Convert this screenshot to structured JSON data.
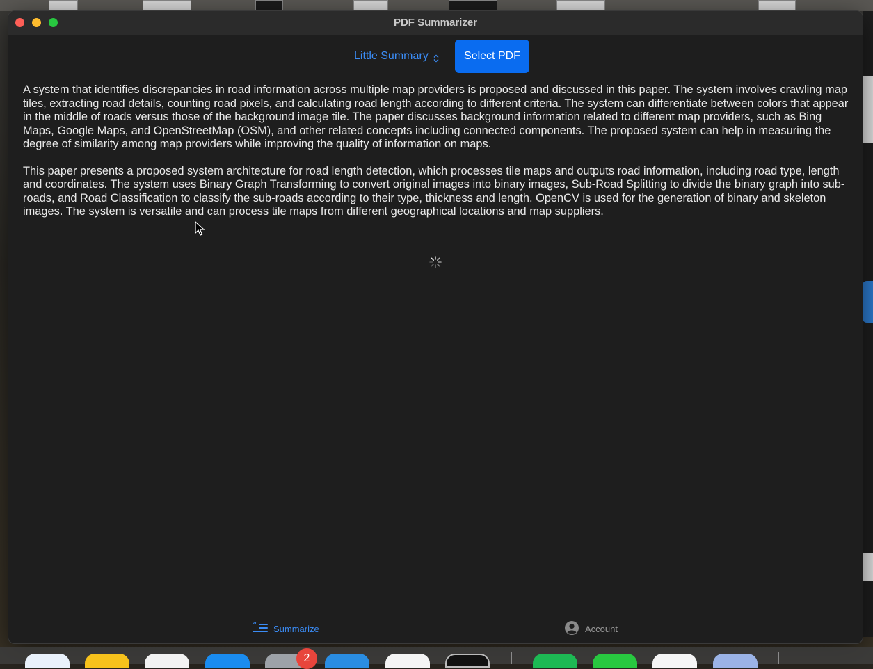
{
  "window": {
    "title": "PDF Summarizer"
  },
  "toolbar": {
    "mode_label": "Little Summary",
    "select_pdf_label": "Select PDF"
  },
  "summary": {
    "paragraphs": [
      "A system that identifies discrepancies in road information across multiple map providers is proposed and discussed in this paper. The system involves crawling map tiles, extracting road details, counting road pixels, and calculating road length according to different criteria. The system can differentiate between colors that appear in the middle of roads versus those of the background image tile. The paper discusses background information related to different map providers, such as Bing Maps, Google Maps, and OpenStreetMap (OSM), and other related concepts including connected components. The proposed system can help in measuring the degree of similarity among map providers while improving the quality of information on maps.",
      "This paper presents a proposed system architecture for road length detection, which processes tile maps and outputs road information, including road type, length and coordinates. The system uses Binary Graph Transforming to convert original images into binary images, Sub-Road Splitting to divide the binary graph into sub-roads, and Road Classification to classify the sub-roads according to their type, thickness and length. OpenCV is used for the generation of binary and skeleton images. The system is versatile and can process tile maps from different geographical locations and map suppliers."
    ]
  },
  "tabs": [
    {
      "label": "Summarize",
      "icon": "quote-list-icon",
      "selected": true
    },
    {
      "label": "Account",
      "icon": "person-circle-icon",
      "selected": false
    }
  ],
  "dock": {
    "badge_count": "2"
  },
  "colors": {
    "accent": "#3b8cf5",
    "button": "#0a6cf0",
    "window_bg": "#1e1e1e",
    "text": "#e9e9e9"
  }
}
